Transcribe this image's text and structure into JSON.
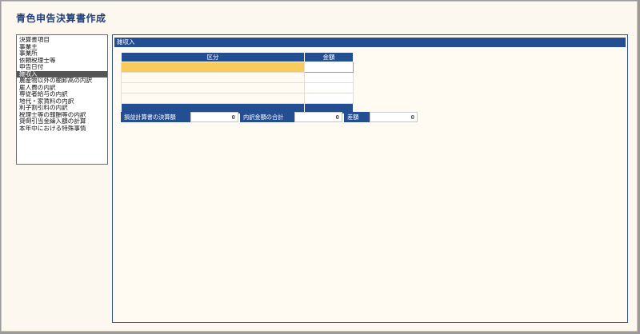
{
  "app": {
    "title": "青色申告決算書作成"
  },
  "sidebar": {
    "items": [
      {
        "label": "決算書項目"
      },
      {
        "label": "事業主"
      },
      {
        "label": "事業所"
      },
      {
        "label": "依頼税理士等"
      },
      {
        "label": "申告日付"
      },
      {
        "label": "雑収入",
        "selected": true
      },
      {
        "label": "農産物以外の棚卸高の内訳"
      },
      {
        "label": "雇人費の内訳"
      },
      {
        "label": "専従者給与の内訳"
      },
      {
        "label": "地代・家賃料の内訳"
      },
      {
        "label": "利子割引料の内訳"
      },
      {
        "label": "税理士等の報酬等の内訳"
      },
      {
        "label": "貸倒引当金繰入額の計算"
      },
      {
        "label": "本年中における特殊事情"
      }
    ]
  },
  "main": {
    "section_title": "雑収入",
    "table": {
      "columns": [
        "区分",
        "金額"
      ],
      "rows": [
        {
          "kubun": "",
          "kingaku": ""
        },
        {
          "kubun": "",
          "kingaku": ""
        },
        {
          "kubun": "",
          "kingaku": ""
        },
        {
          "kubun": "",
          "kingaku": ""
        }
      ]
    },
    "summary": {
      "pl_label": "損益計算書の決算額",
      "pl_value": "0",
      "total_label": "内訳金額の合計",
      "total_value": "0",
      "diff_label": "差額",
      "diff_value": "0"
    }
  },
  "colors": {
    "accent": "#234e92",
    "selected_row": "#f8cc5a",
    "title": "#1e3f7a",
    "background": "#fdf8ef"
  }
}
